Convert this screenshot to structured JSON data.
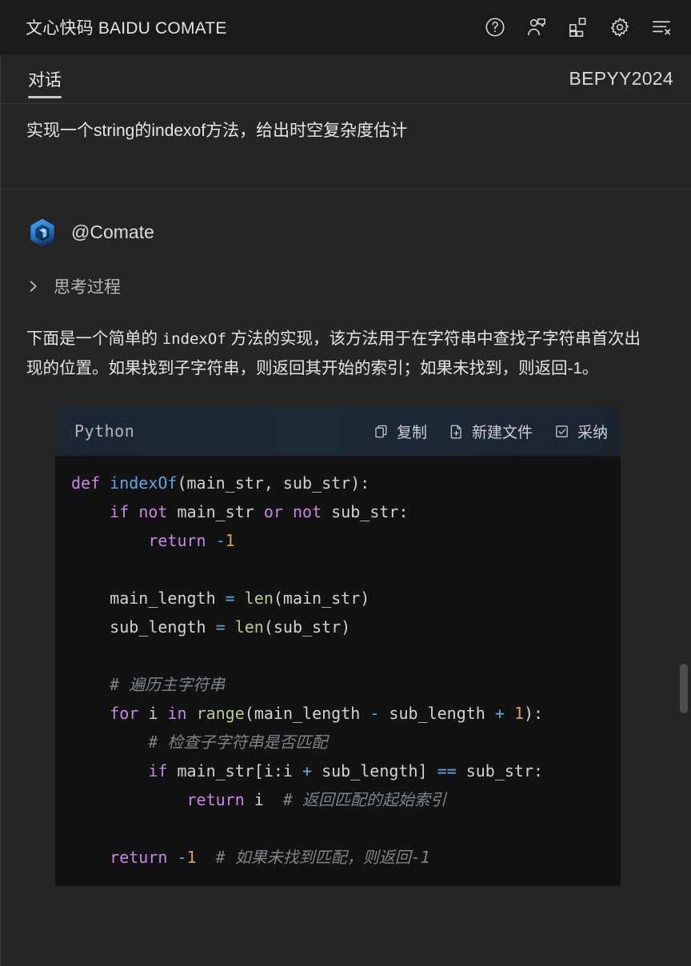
{
  "titlebar": {
    "title": "文心快码 BAIDU COMATE",
    "actions": [
      {
        "name": "help-icon",
        "label": "帮助"
      },
      {
        "name": "feedback-icon",
        "label": "反馈"
      },
      {
        "name": "plugins-icon",
        "label": "插件"
      },
      {
        "name": "settings-icon",
        "label": "设置"
      },
      {
        "name": "clear-list-icon",
        "label": "清空会话"
      }
    ]
  },
  "tabbar": {
    "tabs": [
      {
        "label": "对话",
        "active": true
      }
    ],
    "workspace": "BEPYY2024"
  },
  "conversation": {
    "user_message": "实现一个string的indexof方法，给出时空复杂度估计",
    "assistant": {
      "name": "@Comate",
      "avatar_icon": "comate-hexagon-logo",
      "thinking": {
        "label": "思考过程",
        "expanded": false,
        "chevron_icon": "chevron-right-icon"
      },
      "paragraph_parts": {
        "p1": "下面是一个简单的 ",
        "code1": "indexOf",
        "p2": " 方法的实现，该方法用于在字符串中查找子字符串首次出现的位置。如果找到子字符串，则返回其开始的索引；如果未找到，则返回-1。"
      },
      "codeblock": {
        "language": "Python",
        "actions": [
          {
            "name": "copy-button",
            "label": "复制",
            "icon": "copy-icon"
          },
          {
            "name": "new-file-button",
            "label": "新建文件",
            "icon": "file-plus-icon"
          },
          {
            "name": "adopt-button",
            "label": "采纳",
            "icon": "check-square-icon"
          }
        ],
        "lines": [
          [
            {
              "t": "kw",
              "s": "def"
            },
            {
              "t": "pl",
              "s": " "
            },
            {
              "t": "fn",
              "s": "indexOf"
            },
            {
              "t": "pl",
              "s": "(main_str, sub_str):"
            }
          ],
          [
            {
              "t": "pl",
              "s": "    "
            },
            {
              "t": "kw",
              "s": "if"
            },
            {
              "t": "pl",
              "s": " "
            },
            {
              "t": "kw",
              "s": "not"
            },
            {
              "t": "pl",
              "s": " main_str "
            },
            {
              "t": "kw",
              "s": "or"
            },
            {
              "t": "pl",
              "s": " "
            },
            {
              "t": "kw",
              "s": "not"
            },
            {
              "t": "pl",
              "s": " sub_str:"
            }
          ],
          [
            {
              "t": "pl",
              "s": "        "
            },
            {
              "t": "kw",
              "s": "return"
            },
            {
              "t": "pl",
              "s": " "
            },
            {
              "t": "op",
              "s": "-"
            },
            {
              "t": "num",
              "s": "1"
            }
          ],
          [
            {
              "t": "pl",
              "s": ""
            }
          ],
          [
            {
              "t": "pl",
              "s": "    main_length "
            },
            {
              "t": "op",
              "s": "="
            },
            {
              "t": "pl",
              "s": " "
            },
            {
              "t": "builtin",
              "s": "len"
            },
            {
              "t": "pl",
              "s": "(main_str)"
            }
          ],
          [
            {
              "t": "pl",
              "s": "    sub_length "
            },
            {
              "t": "op",
              "s": "="
            },
            {
              "t": "pl",
              "s": " "
            },
            {
              "t": "builtin",
              "s": "len"
            },
            {
              "t": "pl",
              "s": "(sub_str)"
            }
          ],
          [
            {
              "t": "pl",
              "s": ""
            }
          ],
          [
            {
              "t": "pl",
              "s": "    "
            },
            {
              "t": "cm",
              "s": "# 遍历主字符串"
            }
          ],
          [
            {
              "t": "pl",
              "s": "    "
            },
            {
              "t": "kw",
              "s": "for"
            },
            {
              "t": "pl",
              "s": " i "
            },
            {
              "t": "kw",
              "s": "in"
            },
            {
              "t": "pl",
              "s": " "
            },
            {
              "t": "builtin",
              "s": "range"
            },
            {
              "t": "pl",
              "s": "(main_length "
            },
            {
              "t": "op",
              "s": "-"
            },
            {
              "t": "pl",
              "s": " sub_length "
            },
            {
              "t": "op",
              "s": "+"
            },
            {
              "t": "pl",
              "s": " "
            },
            {
              "t": "num",
              "s": "1"
            },
            {
              "t": "pl",
              "s": "):"
            }
          ],
          [
            {
              "t": "pl",
              "s": "        "
            },
            {
              "t": "cm",
              "s": "# 检查子字符串是否匹配"
            }
          ],
          [
            {
              "t": "pl",
              "s": "        "
            },
            {
              "t": "kw",
              "s": "if"
            },
            {
              "t": "pl",
              "s": " main_str[i:i "
            },
            {
              "t": "op",
              "s": "+"
            },
            {
              "t": "pl",
              "s": " sub_length] "
            },
            {
              "t": "op",
              "s": "=="
            },
            {
              "t": "pl",
              "s": " sub_str:"
            }
          ],
          [
            {
              "t": "pl",
              "s": "            "
            },
            {
              "t": "kw",
              "s": "return"
            },
            {
              "t": "pl",
              "s": " i  "
            },
            {
              "t": "cm",
              "s": "# 返回匹配的起始索引"
            }
          ],
          [
            {
              "t": "pl",
              "s": ""
            }
          ],
          [
            {
              "t": "pl",
              "s": "    "
            },
            {
              "t": "kw",
              "s": "return"
            },
            {
              "t": "pl",
              "s": " "
            },
            {
              "t": "op",
              "s": "-"
            },
            {
              "t": "num",
              "s": "1"
            },
            {
              "t": "pl",
              "s": "  "
            },
            {
              "t": "cm",
              "s": "# 如果未找到匹配，则返回-1"
            }
          ]
        ]
      }
    }
  },
  "colors": {
    "titlebar_bg": "#1a1a1a",
    "panel_bg": "#252525",
    "code_bg": "#121212",
    "code_header_bg": "#1c2733",
    "accent_keyword": "#c586e8",
    "accent_function": "#5aa9e6",
    "accent_builtin": "#b5cc8e",
    "accent_number": "#d9a05b",
    "accent_comment": "#7e8489",
    "scrollbar_thumb": "#4d4d4d"
  }
}
